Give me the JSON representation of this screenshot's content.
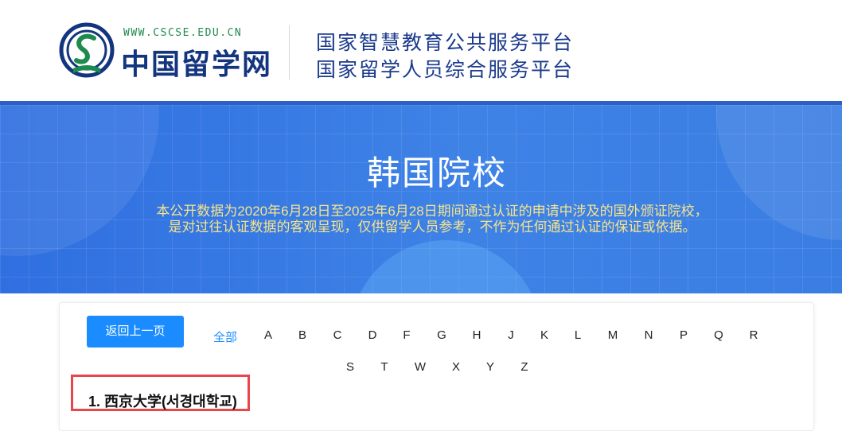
{
  "header": {
    "logo_url": "WWW.CSCSE.EDU.CN",
    "logo_name": "中国留学网",
    "platform_line1": "国家智慧教育公共服务平台",
    "platform_line2": "国家留学人员综合服务平台"
  },
  "banner": {
    "title": "韩国院校",
    "desc_line1": "本公开数据为2020年6月28日至2025年6月28日期间通过认证的申请中涉及的国外颁证院校，",
    "desc_line2": "是对过往认证数据的客观呈现，仅供留学人员参考，不作为任何通过认证的保证或依据。"
  },
  "nav": {
    "back_label": "返回上一页",
    "all_label": "全部",
    "letters": [
      "A",
      "B",
      "C",
      "D",
      "F",
      "G",
      "H",
      "J",
      "K",
      "L",
      "M",
      "N",
      "P",
      "Q",
      "R",
      "S",
      "T",
      "W",
      "X",
      "Y",
      "Z"
    ]
  },
  "schools": [
    {
      "index": "1.",
      "name": "西京大学(서경대학교)"
    }
  ],
  "colors": {
    "accent": "#1a8cff",
    "banner_blue": "#3e82e6",
    "desc_yellow": "#f7e48a",
    "highlight_red": "#e8464d",
    "brand_navy": "#13357f"
  }
}
